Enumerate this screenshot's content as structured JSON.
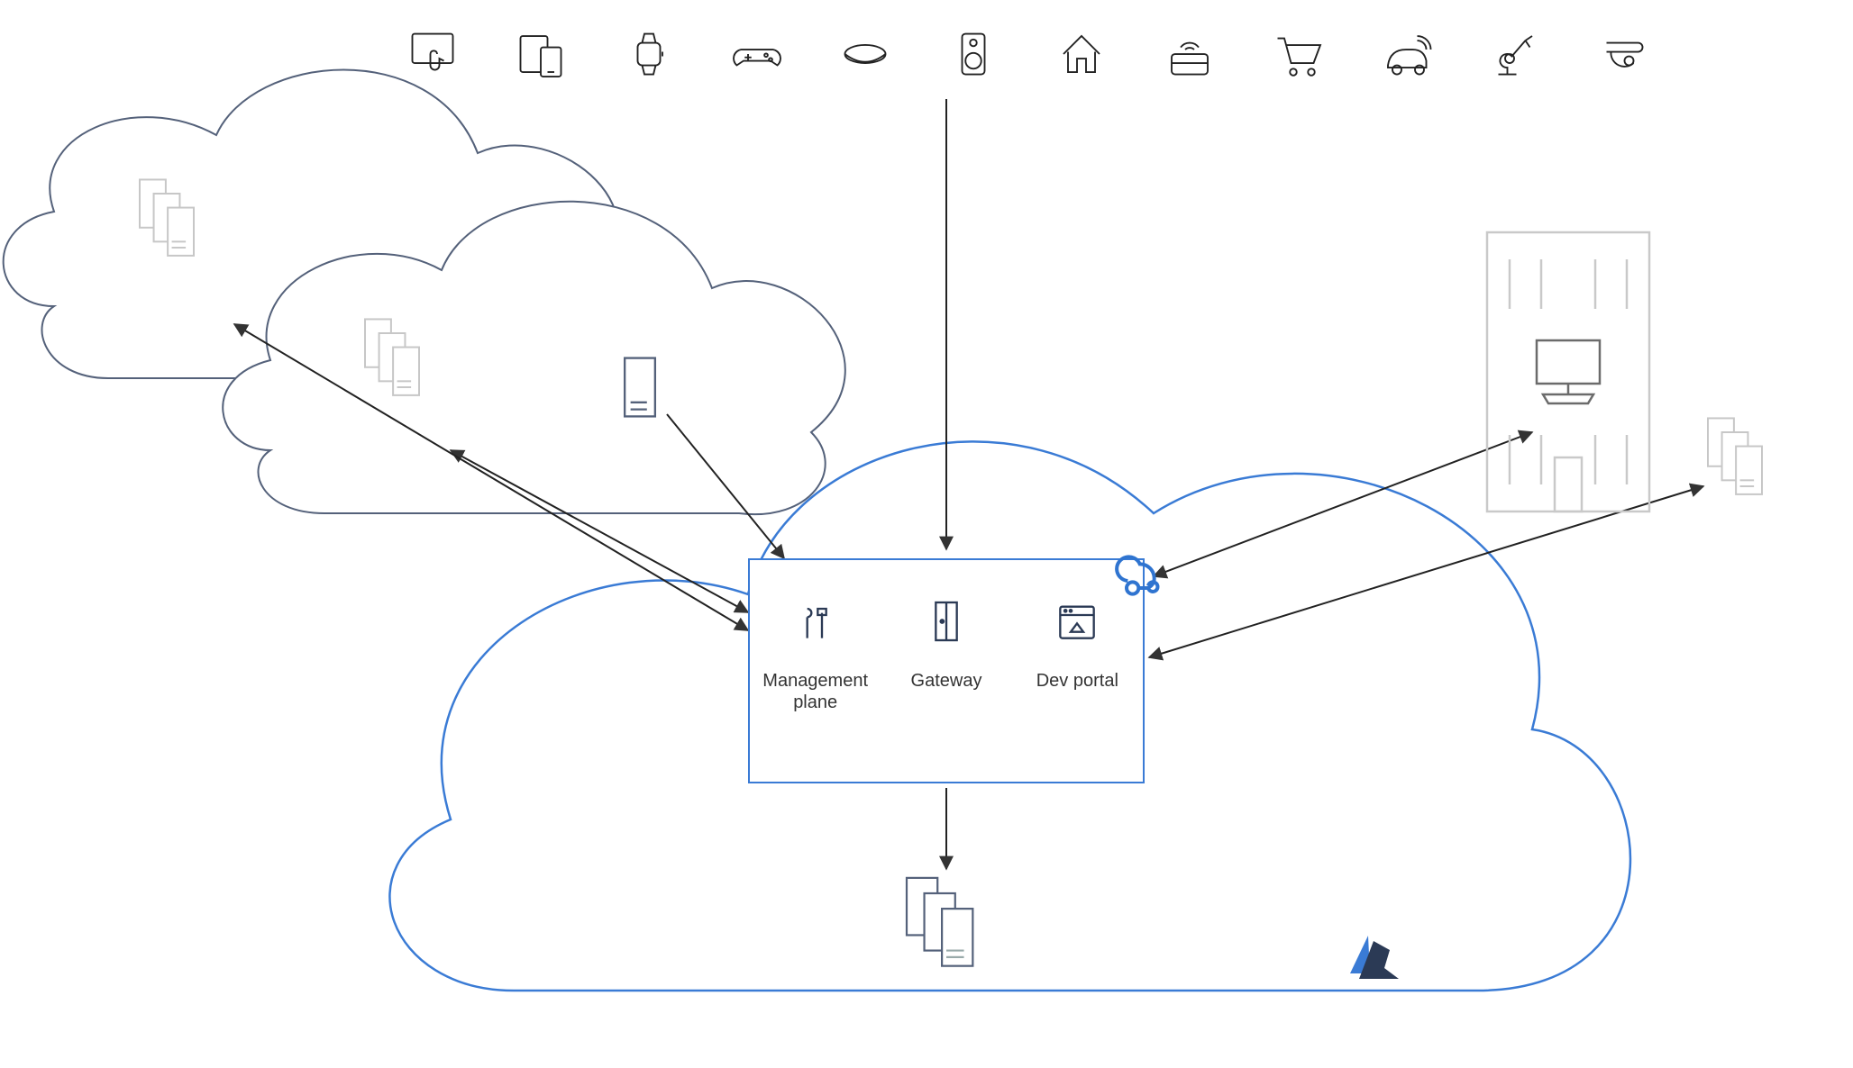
{
  "apim": {
    "management_label": "Management plane",
    "gateway_label": "Gateway",
    "devportal_label": "Dev portal"
  },
  "colors": {
    "azure_blue": "#3a7bd5",
    "dark_outline": "#2b3a55",
    "grey_outline": "#bdbdbd",
    "ink": "#222222"
  },
  "diagram": {
    "description": "Azure API Management architecture: client devices (touch kiosk, mobile, smartwatch, game controller, VR headset, speaker, smart home, card reader, shopping cart, connected car, robot arm, security camera) call through API Management (management plane, gateway, developer portal) hosted in Azure cloud, which fans out to backend APIs in Azure, other clouds, on-premises (building + desktop), and external servers."
  }
}
